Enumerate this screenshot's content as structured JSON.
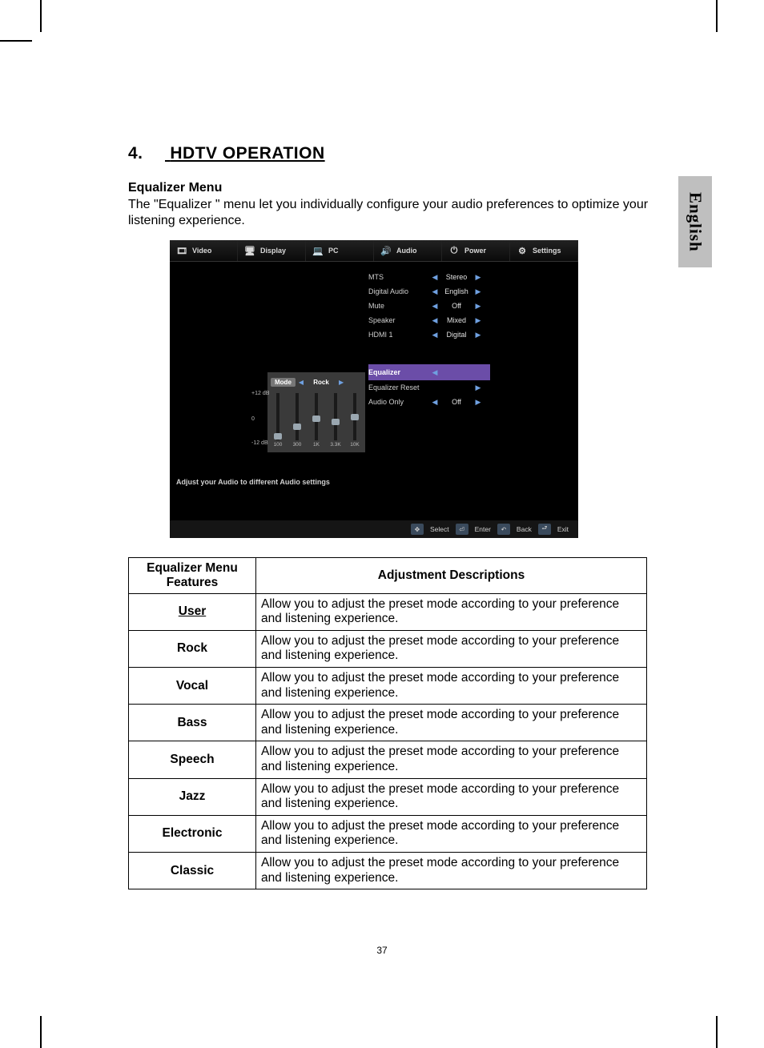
{
  "section": {
    "number": "4.",
    "title": "HDTV OPERATION"
  },
  "subhead": "Equalizer  Menu",
  "body": "The \"Equalizer \" menu let you individually  configure your audio preferences to optimize your listening experience.",
  "language_tab": "English",
  "page_number": "37",
  "osd": {
    "tabs": [
      "Video",
      "Display",
      "PC",
      "Audio",
      "Power",
      "Settings"
    ],
    "items": [
      {
        "label": "MTS",
        "value": "Stereo",
        "left": true,
        "right": true
      },
      {
        "label": "Digital Audio",
        "value": "English",
        "left": true,
        "right": true
      },
      {
        "label": "Mute",
        "value": "Off",
        "left": true,
        "right": true
      },
      {
        "label": "Speaker",
        "value": "Mixed",
        "left": true,
        "right": true
      },
      {
        "label": "HDMI 1",
        "value": "Digital",
        "left": true,
        "right": true
      }
    ],
    "items2": [
      {
        "label": "Equalizer",
        "value": "",
        "left": true,
        "right": false,
        "selected": true
      },
      {
        "label": "Equalizer Reset",
        "value": "",
        "left": false,
        "right": true
      },
      {
        "label": "Audio Only",
        "value": "Off",
        "left": true,
        "right": true
      }
    ],
    "eq": {
      "mode_label": "Mode",
      "mode_value": "Rock",
      "axis": {
        "top": "+12 dB",
        "mid": "0",
        "bot": "-12 dB"
      },
      "bands": [
        {
          "freq": "100",
          "pos": 50
        },
        {
          "freq": "300",
          "pos": 38
        },
        {
          "freq": "1K",
          "pos": 28
        },
        {
          "freq": "3.3K",
          "pos": 32
        },
        {
          "freq": "10K",
          "pos": 26
        }
      ]
    },
    "hint": "Adjust your Audio to different Audio settings",
    "nav": {
      "select": "Select",
      "enter": "Enter",
      "back": "Back",
      "exit": "Exit"
    }
  },
  "table": {
    "header_left": "Equalizer  Menu Features",
    "header_right": "Adjustment Descriptions",
    "common_desc": "Allow you to adjust the preset  mode according to your preference and  listening experience.",
    "rows": [
      {
        "name": "User",
        "underline": true
      },
      {
        "name": "Rock"
      },
      {
        "name": "Vocal"
      },
      {
        "name": "Bass"
      },
      {
        "name": "Speech"
      },
      {
        "name": "Jazz"
      },
      {
        "name": "Electronic"
      },
      {
        "name": "Classic"
      }
    ]
  }
}
